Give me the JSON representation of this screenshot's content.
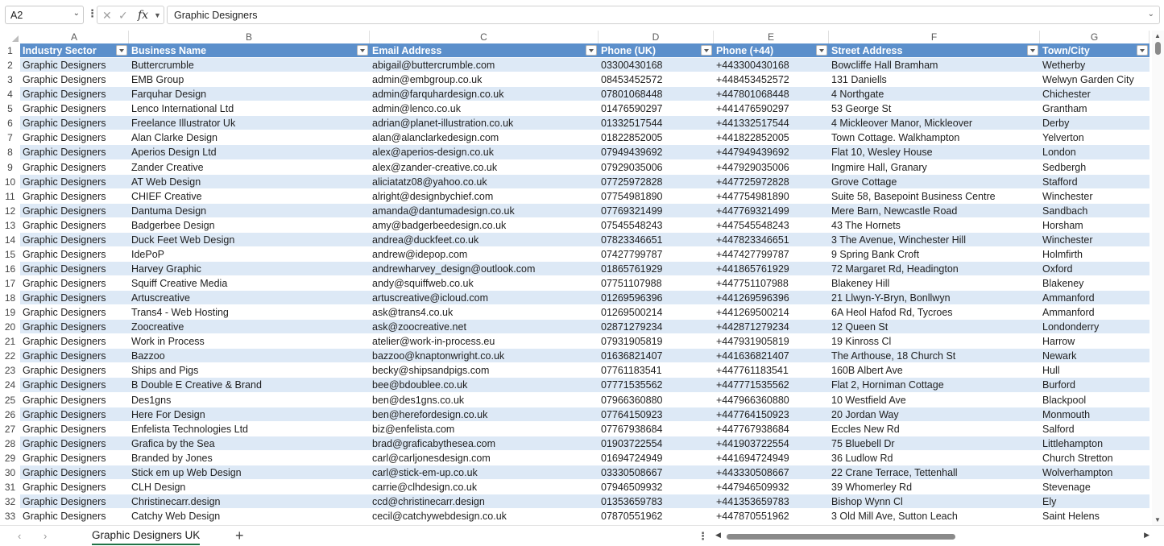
{
  "formula_bar": {
    "name_box": "A2",
    "formula": "Graphic Designers",
    "fx_label": "fx"
  },
  "columns": [
    "A",
    "B",
    "C",
    "D",
    "E",
    "F",
    "G"
  ],
  "headers": [
    "Industry Sector",
    "Business Name",
    "Email Address",
    "Phone (UK)",
    "Phone (+44)",
    "Street Address",
    "Town/City"
  ],
  "rows": [
    [
      "Graphic Designers",
      "Buttercrumble",
      "abigail@buttercrumble.com",
      "03300430168",
      "+443300430168",
      "Bowcliffe Hall Bramham",
      "Wetherby"
    ],
    [
      "Graphic Designers",
      "EMB Group",
      "admin@embgroup.co.uk",
      "08453452572",
      "+448453452572",
      "131 Daniells",
      "Welwyn Garden City"
    ],
    [
      "Graphic Designers",
      "Farquhar Design",
      "admin@farquhardesign.co.uk",
      "07801068448",
      "+447801068448",
      "4 Northgate",
      "Chichester"
    ],
    [
      "Graphic Designers",
      "Lenco International Ltd",
      "admin@lenco.co.uk",
      "01476590297",
      "+441476590297",
      "53 George St",
      "Grantham"
    ],
    [
      "Graphic Designers",
      "Freelance Illustrator Uk",
      "adrian@planet-illustration.co.uk",
      "01332517544",
      "+441332517544",
      "4 Mickleover Manor, Mickleover",
      "Derby"
    ],
    [
      "Graphic Designers",
      "Alan Clarke Design",
      "alan@alanclarkedesign.com",
      "01822852005",
      "+441822852005",
      "Town Cottage. Walkhampton",
      "Yelverton"
    ],
    [
      "Graphic Designers",
      "Aperios Design Ltd",
      "alex@aperios-design.co.uk",
      "07949439692",
      "+447949439692",
      "Flat 10, Wesley House",
      "London"
    ],
    [
      "Graphic Designers",
      "Zander Creative",
      "alex@zander-creative.co.uk",
      "07929035006",
      "+447929035006",
      "Ingmire Hall, Granary",
      "Sedbergh"
    ],
    [
      "Graphic Designers",
      "AT Web Design",
      "aliciatatz08@yahoo.co.uk",
      "07725972828",
      "+447725972828",
      "Grove Cottage",
      "Stafford"
    ],
    [
      "Graphic Designers",
      "CHIEF Creative",
      "alright@designbychief.com",
      "07754981890",
      "+447754981890",
      "Suite 58, Basepoint Business Centre",
      "Winchester"
    ],
    [
      "Graphic Designers",
      "Dantuma Design",
      "amanda@dantumadesign.co.uk",
      "07769321499",
      "+447769321499",
      "Mere Barn, Newcastle Road",
      "Sandbach"
    ],
    [
      "Graphic Designers",
      "Badgerbee Design",
      "amy@badgerbeedesign.co.uk",
      "07545548243",
      "+447545548243",
      "43 The Hornets",
      "Horsham"
    ],
    [
      "Graphic Designers",
      "Duck Feet Web Design",
      "andrea@duckfeet.co.uk",
      "07823346651",
      "+447823346651",
      "3 The Avenue, Winchester Hill",
      "Winchester"
    ],
    [
      "Graphic Designers",
      "IdePoP",
      "andrew@idepop.com",
      "07427799787",
      "+447427799787",
      "9 Spring Bank Croft",
      "Holmfirth"
    ],
    [
      "Graphic Designers",
      "Harvey Graphic",
      "andrewharvey_design@outlook.com",
      "01865761929",
      "+441865761929",
      "72 Margaret Rd, Headington",
      "Oxford"
    ],
    [
      "Graphic Designers",
      "Squiff Creative Media",
      "andy@squiffweb.co.uk",
      "07751107988",
      "+447751107988",
      "Blakeney Hill",
      "Blakeney"
    ],
    [
      "Graphic Designers",
      "Artuscreative",
      "artuscreative@icloud.com",
      "01269596396",
      "+441269596396",
      "21 Llwyn-Y-Bryn, Bonllwyn",
      "Ammanford"
    ],
    [
      "Graphic Designers",
      "Trans4 - Web Hosting",
      "ask@trans4.co.uk",
      "01269500214",
      "+441269500214",
      "6A Heol Hafod Rd, Tycroes",
      "Ammanford"
    ],
    [
      "Graphic Designers",
      "Zoocreative",
      "ask@zoocreative.net",
      "02871279234",
      "+442871279234",
      "12 Queen St",
      "Londonderry"
    ],
    [
      "Graphic Designers",
      "Work in Process",
      "atelier@work-in-process.eu",
      "07931905819",
      "+447931905819",
      "19 Kinross Cl",
      "Harrow"
    ],
    [
      "Graphic Designers",
      "Bazzoo",
      "bazzoo@knaptonwright.co.uk",
      "01636821407",
      "+441636821407",
      "The Arthouse, 18 Church St",
      "Newark"
    ],
    [
      "Graphic Designers",
      "Ships and Pigs",
      "becky@shipsandpigs.com",
      "07761183541",
      "+447761183541",
      "160B Albert Ave",
      "Hull"
    ],
    [
      "Graphic Designers",
      "B Double E Creative & Brand",
      "bee@bdoublee.co.uk",
      "07771535562",
      "+447771535562",
      "Flat 2, Horniman Cottage",
      "Burford"
    ],
    [
      "Graphic Designers",
      "Des1gns",
      "ben@des1gns.co.uk",
      "07966360880",
      "+447966360880",
      "10 Westfield Ave",
      "Blackpool"
    ],
    [
      "Graphic Designers",
      "Here For Design",
      "ben@herefordesign.co.uk",
      "07764150923",
      "+447764150923",
      "20 Jordan Way",
      "Monmouth"
    ],
    [
      "Graphic Designers",
      "Enfelista Technologies Ltd",
      "biz@enfelista.com",
      "07767938684",
      "+447767938684",
      "Eccles New Rd",
      "Salford"
    ],
    [
      "Graphic Designers",
      "Grafica by the Sea",
      "brad@graficabythesea.com",
      "01903722554",
      "+441903722554",
      "75 Bluebell Dr",
      "Littlehampton"
    ],
    [
      "Graphic Designers",
      "Branded by Jones",
      "carl@carljonesdesign.com",
      "01694724949",
      "+441694724949",
      "36 Ludlow Rd",
      "Church Stretton"
    ],
    [
      "Graphic Designers",
      "Stick em up Web Design",
      "carl@stick-em-up.co.uk",
      "03330508667",
      "+443330508667",
      "22 Crane Terrace, Tettenhall",
      "Wolverhampton"
    ],
    [
      "Graphic Designers",
      "CLH Design",
      "carrie@clhdesign.co.uk",
      "07946509932",
      "+447946509932",
      "39 Whomerley Rd",
      "Stevenage"
    ],
    [
      "Graphic Designers",
      "Christinecarr.design",
      "ccd@christinecarr.design",
      "01353659783",
      "+441353659783",
      "Bishop Wynn Cl",
      "Ely"
    ],
    [
      "Graphic Designers",
      "Catchy Web Design",
      "cecil@catchywebdesign.co.uk",
      "07870551962",
      "+447870551962",
      "3 Old Mill Ave, Sutton Leach",
      "Saint Helens"
    ]
  ],
  "row_numbers": [
    "1",
    "2",
    "3",
    "4",
    "5",
    "6",
    "7",
    "8",
    "9",
    "10",
    "11",
    "12",
    "13",
    "14",
    "15",
    "16",
    "17",
    "18",
    "19",
    "20",
    "21",
    "22",
    "23",
    "24",
    "25",
    "26",
    "27",
    "28",
    "29",
    "30",
    "31",
    "32",
    "33"
  ],
  "sheet_tab": "Graphic Designers UK",
  "add_sheet_label": "+",
  "colors": {
    "header_fill": "#5b8fcb",
    "band_fill": "#dde9f6",
    "tab_underline": "#217346"
  }
}
